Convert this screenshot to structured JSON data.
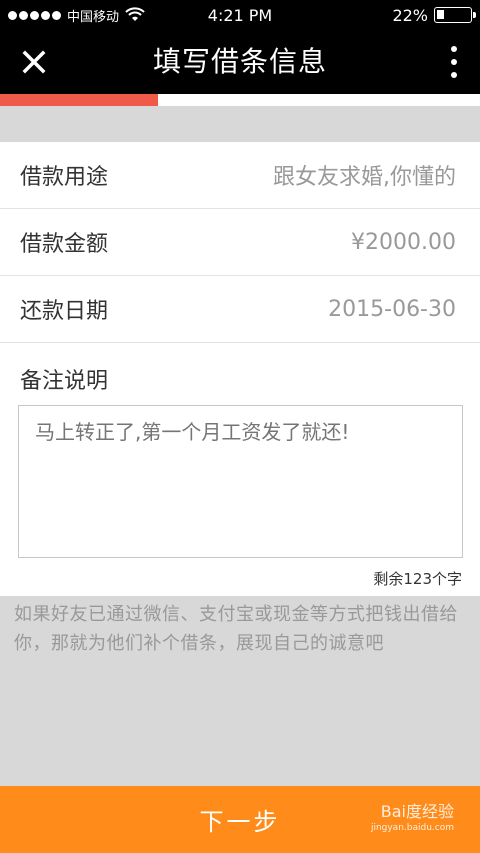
{
  "status_bar": {
    "carrier": "中国移动",
    "time": "4:21 PM",
    "battery": "22%",
    "battery_level": 0.22
  },
  "nav": {
    "title": "填写借条信息"
  },
  "progress": {
    "fraction": 0.33,
    "color": "#f05a4a"
  },
  "form": {
    "rows": [
      {
        "label": "借款用途",
        "value": "跟女友求婚,你懂的"
      },
      {
        "label": "借款金额",
        "value": "¥2000.00"
      },
      {
        "label": "还款日期",
        "value": "2015-06-30"
      }
    ],
    "remark": {
      "label": "备注说明",
      "value": "马上转正了,第一个月工资发了就还!",
      "remaining": "剩余123个字"
    }
  },
  "hint": "如果好友已通过微信、支付宝或现金等方式把钱出借给你，那就为他们补个借条，展现自己的诚意吧",
  "next_button": {
    "label": "下一步",
    "color": "#ff8c1a"
  },
  "watermark": {
    "brand": "Bai⁠度经验",
    "url": "jingyan.baidu.com"
  }
}
